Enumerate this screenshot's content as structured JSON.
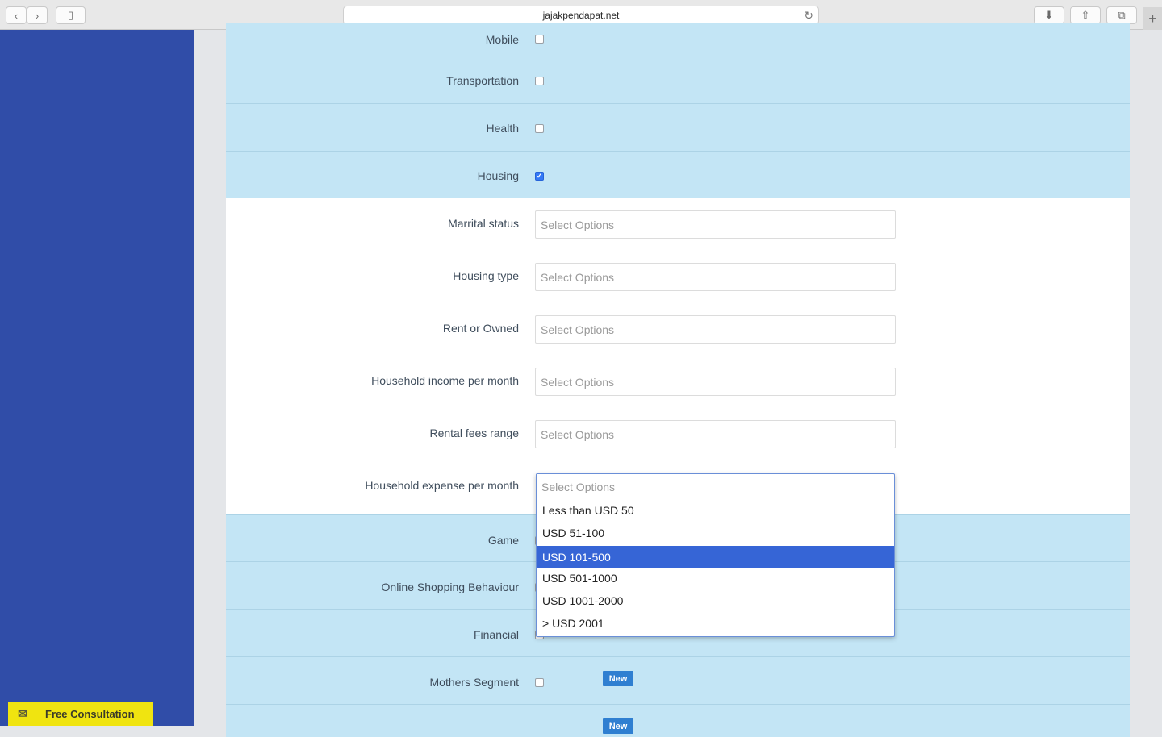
{
  "browser": {
    "url": "jajakpendapat.net",
    "back_glyph": "‹",
    "forward_glyph": "›",
    "sidebar_glyph": "▯",
    "reload_glyph": "↻",
    "download_glyph": "⬇",
    "share_glyph": "⇧",
    "tabs_glyph": "⧉",
    "newtab_glyph": "+"
  },
  "interests_top": [
    {
      "label": "Mobile",
      "checked": false
    },
    {
      "label": "Transportation",
      "checked": false
    },
    {
      "label": "Health",
      "checked": false
    },
    {
      "label": "Housing",
      "checked": true
    }
  ],
  "housing_fields": [
    {
      "label": "Marrital status",
      "placeholder": "Select Options"
    },
    {
      "label": "Housing type",
      "placeholder": "Select Options"
    },
    {
      "label": "Rent or Owned",
      "placeholder": "Select Options"
    },
    {
      "label": "Household income per month",
      "placeholder": "Select Options"
    },
    {
      "label": "Rental fees range",
      "placeholder": "Select Options"
    },
    {
      "label": "Household expense per month",
      "placeholder": "Select Options"
    }
  ],
  "dropdown": {
    "placeholder": "Select Options",
    "options": [
      "Less than USD 50",
      "USD 51-100",
      "USD 101-500",
      "USD 501-1000",
      "USD 1001-2000",
      "> USD 2001"
    ],
    "highlighted": "USD 101-500"
  },
  "interests_bottom": [
    {
      "label": "Game",
      "checked": false,
      "badge": ""
    },
    {
      "label": "Online Shopping Behaviour",
      "checked": false,
      "badge": ""
    },
    {
      "label": "Financial",
      "checked": false,
      "badge": ""
    },
    {
      "label": "Mothers Segment",
      "checked": false,
      "badge": "New"
    },
    {
      "label": "",
      "checked": false,
      "badge": "New"
    }
  ],
  "consultation": {
    "label": "Free Consultation",
    "icon": "mail-icon",
    "glyph": "✉"
  },
  "colors": {
    "sidebar": "#304da8",
    "row_blue": "#c3e5f5",
    "accent": "#3665d6",
    "badge": "#2f7fd1",
    "consult": "#f0e410"
  }
}
